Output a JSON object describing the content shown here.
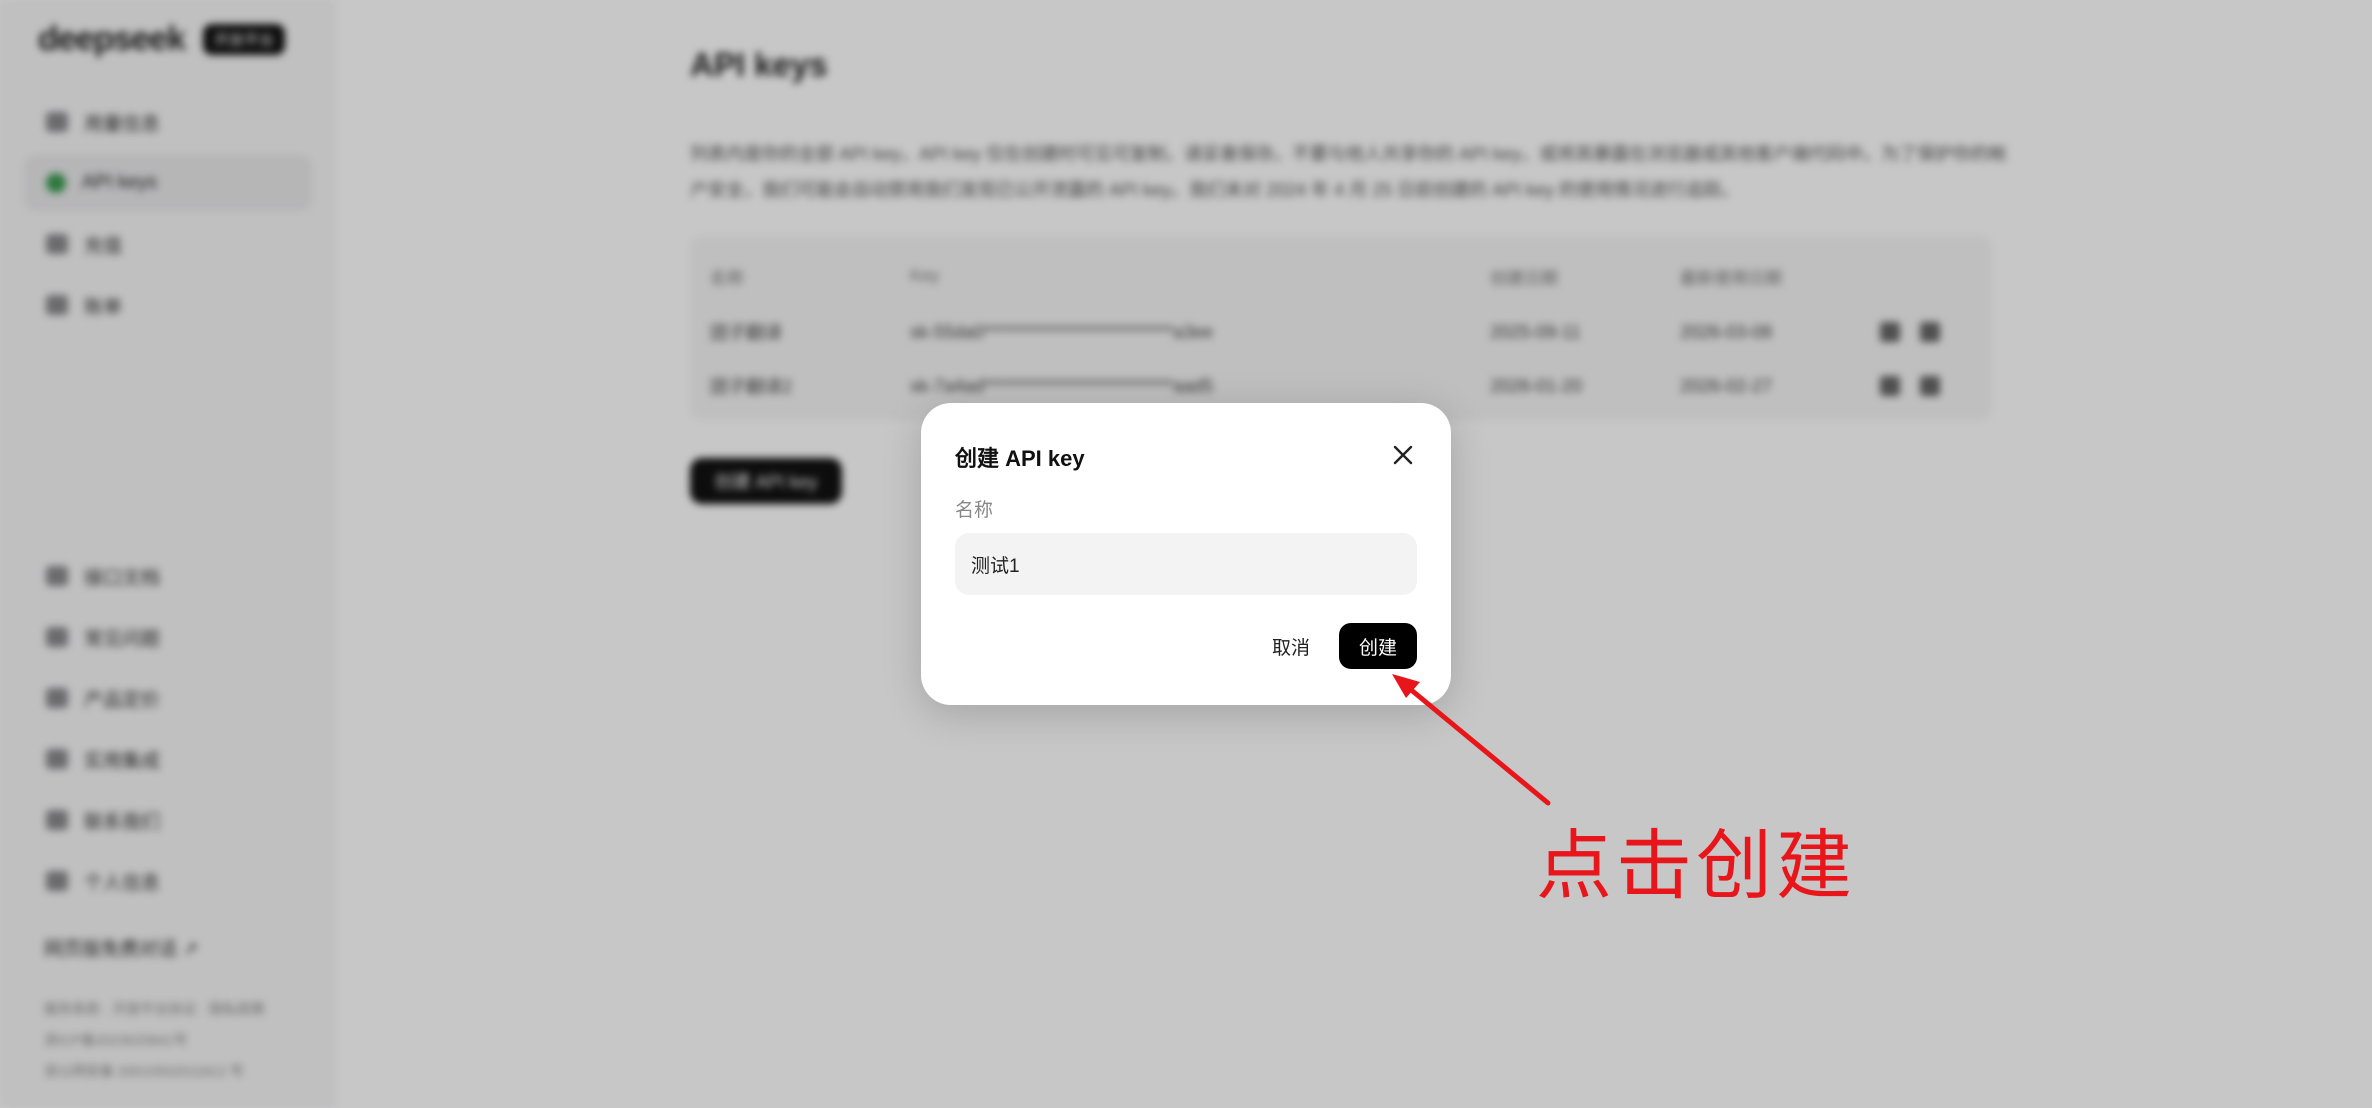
{
  "sidebar": {
    "logo": "deepseek",
    "badge": "开放平台",
    "top_items": [
      {
        "label": "用量信息",
        "icon": "bar-chart-icon"
      },
      {
        "label": "API keys",
        "icon": "search-icon",
        "active": true
      },
      {
        "label": "充值",
        "icon": "card-icon"
      },
      {
        "label": "账单",
        "icon": "bill-icon"
      }
    ],
    "bottom_items": [
      {
        "label": "接口文档",
        "icon": "document-icon"
      },
      {
        "label": "常见问题",
        "icon": "help-icon"
      },
      {
        "label": "产品定价",
        "icon": "price-tag-icon"
      },
      {
        "label": "实用集成",
        "icon": "plugin-icon"
      },
      {
        "label": "联系我们",
        "icon": "send-icon"
      },
      {
        "label": "个人信息",
        "icon": "user-icon"
      }
    ],
    "chat_link": "网页版免费对话 ↗",
    "footer": [
      "服务条款 · 开放平台协议 · 隐私政策",
      "浙ICP备2023025841号",
      "浙公网安备 33010502011812 号"
    ]
  },
  "main": {
    "title": "API keys",
    "description": "列表内是你的全部 API key，API key 仅在创建时可见可复制，请妥善保存。不要与他人共享你的 API key，或将其暴露在浏览器或其他客户端代码中。为了保护你的帐户安全，我们可能会自动禁用我们发现已公开泄露的 API key。我们未对 2024 年 4 月 25 日前创建的 API key 的使用情况进行追踪。",
    "table": {
      "headers": [
        "名称",
        "Key",
        "创建日期",
        "最新使用日期"
      ],
      "rows": [
        {
          "name": "团子翻译",
          "key": "sk-55da0***************************a3ee",
          "created": "2025-09-11",
          "last_used": "2026-03-08"
        },
        {
          "name": "团子翻译2",
          "key": "sk-7a4ad***************************aad5",
          "created": "2026-01-20",
          "last_used": "2026-02-27"
        }
      ]
    },
    "create_button": "创建 API key"
  },
  "modal": {
    "title": "创建 API key",
    "field_label": "名称",
    "input_value": "测试1",
    "cancel_label": "取消",
    "confirm_label": "创建"
  },
  "annotation": {
    "text": "点击创建",
    "color": "#e8151b"
  }
}
